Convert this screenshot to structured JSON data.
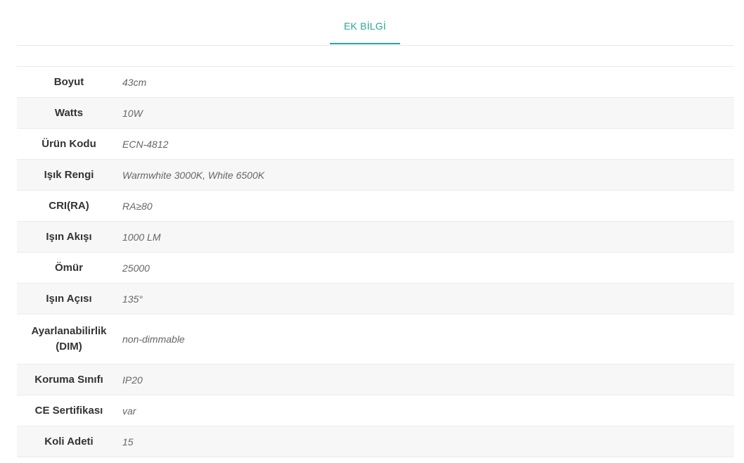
{
  "tabs": [
    {
      "label": "EK BİLGİ",
      "active": true
    }
  ],
  "colors": {
    "accent": "#26a69a",
    "row_alt": "#f7f7f7",
    "border": "#ececec"
  },
  "specs": [
    {
      "label": "Boyut",
      "value": "43cm"
    },
    {
      "label": "Watts",
      "value": "10W"
    },
    {
      "label": "Ürün Kodu",
      "value": "ECN-4812"
    },
    {
      "label": "Işık Rengi",
      "value": "Warmwhite 3000K, White 6500K"
    },
    {
      "label": "CRI(RA)",
      "value": "RA≥80"
    },
    {
      "label": "Işın Akışı",
      "value": "1000 LM"
    },
    {
      "label": "Ömür",
      "value": "25000"
    },
    {
      "label": "Işın Açısı",
      "value": "135°"
    },
    {
      "label": "Ayarlanabilirlik (DIM)",
      "value": "non-dimmable"
    },
    {
      "label": "Koruma Sınıfı",
      "value": "IP20"
    },
    {
      "label": "CE Sertifikası",
      "value": "var"
    },
    {
      "label": "Koli Adeti",
      "value": "15"
    }
  ]
}
